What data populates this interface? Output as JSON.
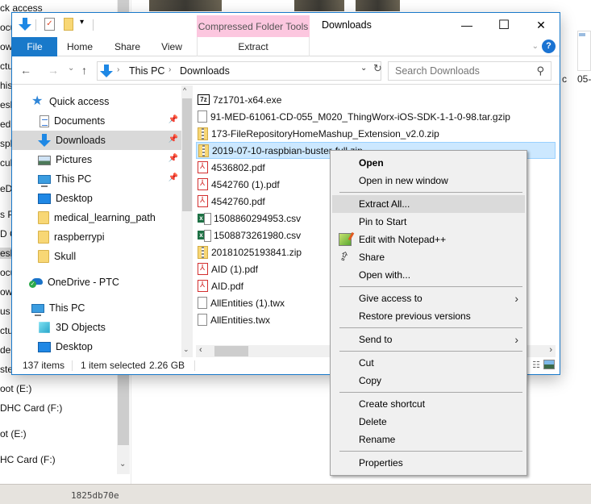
{
  "background": {
    "left_pane_items": [
      "ck access",
      "ocu",
      "ow",
      "ctu",
      "his",
      "esk",
      "ed",
      "spl",
      "cull",
      "eDr",
      "s P",
      "D C",
      "esk",
      "ocu",
      "ow",
      "us",
      "ctu",
      "de",
      "ste...",
      "oot (E:)",
      "DHC Card (F:)",
      "ot (E:)",
      "HC Card (F:)"
    ],
    "label_c": "c",
    "label_05": "05-",
    "bottom_code": "1825db70e"
  },
  "window": {
    "title": "Downloads",
    "contextual_tab_group": "Compressed Folder Tools",
    "controls": {
      "minimize": "—",
      "maximize": "☐",
      "close": "✕"
    },
    "help": "?"
  },
  "ribbon": {
    "tabs": [
      {
        "label": "File",
        "active": true
      },
      {
        "label": "Home"
      },
      {
        "label": "Share"
      },
      {
        "label": "View"
      },
      {
        "label": "Extract"
      }
    ]
  },
  "navigation": {
    "back": "←",
    "forward": "→",
    "recent": "⌄",
    "up": "↑",
    "breadcrumb": [
      "This PC",
      "Downloads"
    ],
    "separator": "›",
    "search_placeholder": "Search Downloads"
  },
  "nav_pane": {
    "items": [
      {
        "label": "Quick access",
        "icon": "star-icon",
        "level": 0
      },
      {
        "label": "Documents",
        "icon": "documents-icon",
        "level": 1,
        "pinned": true
      },
      {
        "label": "Downloads",
        "icon": "downloads-icon",
        "level": 1,
        "pinned": true,
        "selected": true
      },
      {
        "label": "Pictures",
        "icon": "pictures-icon",
        "level": 1,
        "pinned": true
      },
      {
        "label": "This PC",
        "icon": "pc-icon",
        "level": 1,
        "pinned": true
      },
      {
        "label": "Desktop",
        "icon": "desktop-icon",
        "level": 1
      },
      {
        "label": "medical_learning_path",
        "icon": "folder-icon",
        "level": 1
      },
      {
        "label": "raspberrypi",
        "icon": "folder-icon",
        "level": 1
      },
      {
        "label": "Skull",
        "icon": "folder-icon",
        "level": 1
      },
      {
        "label": "OneDrive - PTC",
        "icon": "onedrive-icon",
        "level": 0
      },
      {
        "label": "This PC",
        "icon": "pc-icon",
        "level": 0
      },
      {
        "label": "3D Objects",
        "icon": "3d-objects-icon",
        "level": 1
      },
      {
        "label": "Desktop",
        "icon": "desktop-icon",
        "level": 1
      }
    ]
  },
  "files": [
    {
      "name": "7z1701-x64.exe",
      "type": "7z"
    },
    {
      "name": "91-MED-61061-CD-055_M020_ThingWorx-iOS-SDK-1-1-0-98.tar.gzip",
      "type": "doc"
    },
    {
      "name": "173-FileRepositoryHomeMashup_Extension_v2.0.zip",
      "type": "zip"
    },
    {
      "name": "2019-07-10-raspbian-buster-full.zip",
      "type": "zip",
      "selected": true
    },
    {
      "name": "4536802.pdf",
      "type": "pdf"
    },
    {
      "name": "4542760 (1).pdf",
      "type": "pdf"
    },
    {
      "name": "4542760.pdf",
      "type": "pdf"
    },
    {
      "name": "1508860294953.csv",
      "type": "csv"
    },
    {
      "name": "1508873261980.csv",
      "type": "csv"
    },
    {
      "name": "20181025193841.zip",
      "type": "zip"
    },
    {
      "name": "AID (1).pdf",
      "type": "pdf"
    },
    {
      "name": "AID.pdf",
      "type": "pdf"
    },
    {
      "name": "AllEntities (1).twx",
      "type": "doc"
    },
    {
      "name": "AllEntities.twx",
      "type": "doc"
    }
  ],
  "status": {
    "item_count": "137 items",
    "selection": "1 item selected",
    "size": "2.26 GB"
  },
  "context_menu": {
    "items": [
      {
        "label": "Open",
        "bold": true
      },
      {
        "label": "Open in new window"
      },
      {
        "separator": true
      },
      {
        "label": "Extract All...",
        "highlighted": true
      },
      {
        "label": "Pin to Start"
      },
      {
        "label": "Edit with Notepad++",
        "icon": "notepadpp-icon"
      },
      {
        "label": "Share",
        "icon": "share-icon"
      },
      {
        "label": "Open with..."
      },
      {
        "separator": true
      },
      {
        "label": "Give access to",
        "submenu": true
      },
      {
        "label": "Restore previous versions"
      },
      {
        "separator": true
      },
      {
        "label": "Send to",
        "submenu": true
      },
      {
        "separator": true
      },
      {
        "label": "Cut"
      },
      {
        "label": "Copy"
      },
      {
        "separator": true
      },
      {
        "label": "Create shortcut"
      },
      {
        "label": "Delete"
      },
      {
        "label": "Rename"
      },
      {
        "separator": true
      },
      {
        "label": "Properties"
      }
    ],
    "submenu_arrow": "›"
  }
}
